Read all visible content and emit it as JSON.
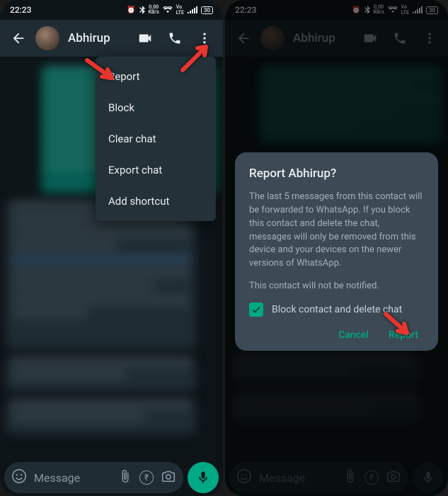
{
  "status": {
    "time": "22:23",
    "kbps": "0.00",
    "kbps_unit": "KB/s",
    "battery": "30"
  },
  "header": {
    "contact_name": "Abhirup"
  },
  "menu": {
    "items": [
      {
        "label": "Report"
      },
      {
        "label": "Block"
      },
      {
        "label": "Clear chat"
      },
      {
        "label": "Export chat"
      },
      {
        "label": "Add shortcut"
      }
    ]
  },
  "composer": {
    "placeholder": "Message"
  },
  "dialog": {
    "title": "Report Abhirup?",
    "body": "The last 5 messages from this contact will be forwarded to WhatsApp. If you block this contact and delete the chat, messages will only be removed from this device and your devices on the newer versions of WhatsApp.",
    "note": "This contact will not be notified.",
    "checkbox_label": "Block contact and delete chat",
    "cancel": "Cancel",
    "report": "Report"
  }
}
